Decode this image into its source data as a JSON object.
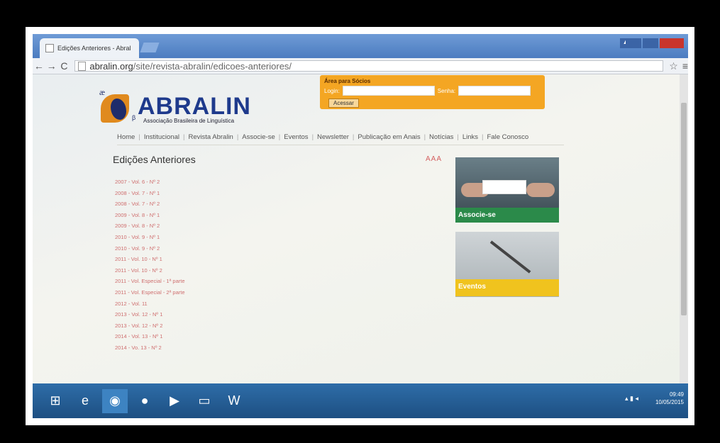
{
  "browser": {
    "tab_title": "Edições Anteriores - Abral",
    "url_domain": "abralin.org",
    "url_path": "/site/revista-abralin/edicoes-anteriores/"
  },
  "site": {
    "logo_ae": "æ",
    "logo_name": "ABRALIN",
    "logo_beta": "β",
    "logo_subtitle": "Associação Brasileira de Linguística",
    "members": {
      "title": "Área para Sócios",
      "login_label": "Login:",
      "password_label": "Senha:",
      "submit_label": "Acessar"
    },
    "nav": [
      "Home",
      "Institucional",
      "Revista Abralin",
      "Associe-se",
      "Eventos",
      "Newsletter",
      "Publicação em Anais",
      "Notícias",
      "Links",
      "Fale Conosco"
    ],
    "nav_separator": "|",
    "heading": "Edições Anteriores",
    "font_size_control": "AAA",
    "editions": [
      "2007 - Vol. 6 - Nº 2",
      "2008 - Vol. 7 - Nº 1",
      "2008 - Vol. 7 - Nº 2",
      "2009 - Vol. 8 - Nº 1",
      "2009 - Vol. 8 - Nº 2",
      "2010 - Vol. 9 - Nº 1",
      "2010 - Vol. 9 - Nº 2",
      "2011 - Vol. 10 - Nº 1",
      "2011 - Vol. 10 - Nº 2",
      "2011 - Vol. Especial - 1ª parte",
      "2011 - Vol. Especial - 2ª parte",
      "2012 - Vol. 11",
      "2013 - Vol. 12 - Nº 1",
      "2013 - Vol. 12 - Nº 2",
      "2014 - Vol. 13 - Nº 1",
      "2014 - Vo. 13 - Nº 2"
    ],
    "promos": [
      {
        "label": "Associe-se",
        "color": "#2b8a4a"
      },
      {
        "label": "Eventos",
        "color": "#f0c31e"
      }
    ]
  },
  "taskbar": {
    "time": "09:49",
    "date": "10/05/2015",
    "apps": [
      "windows-icon",
      "internet-explorer-icon",
      "chrome-icon",
      "firefox-icon",
      "media-icon",
      "file-explorer-icon",
      "word-icon"
    ]
  }
}
